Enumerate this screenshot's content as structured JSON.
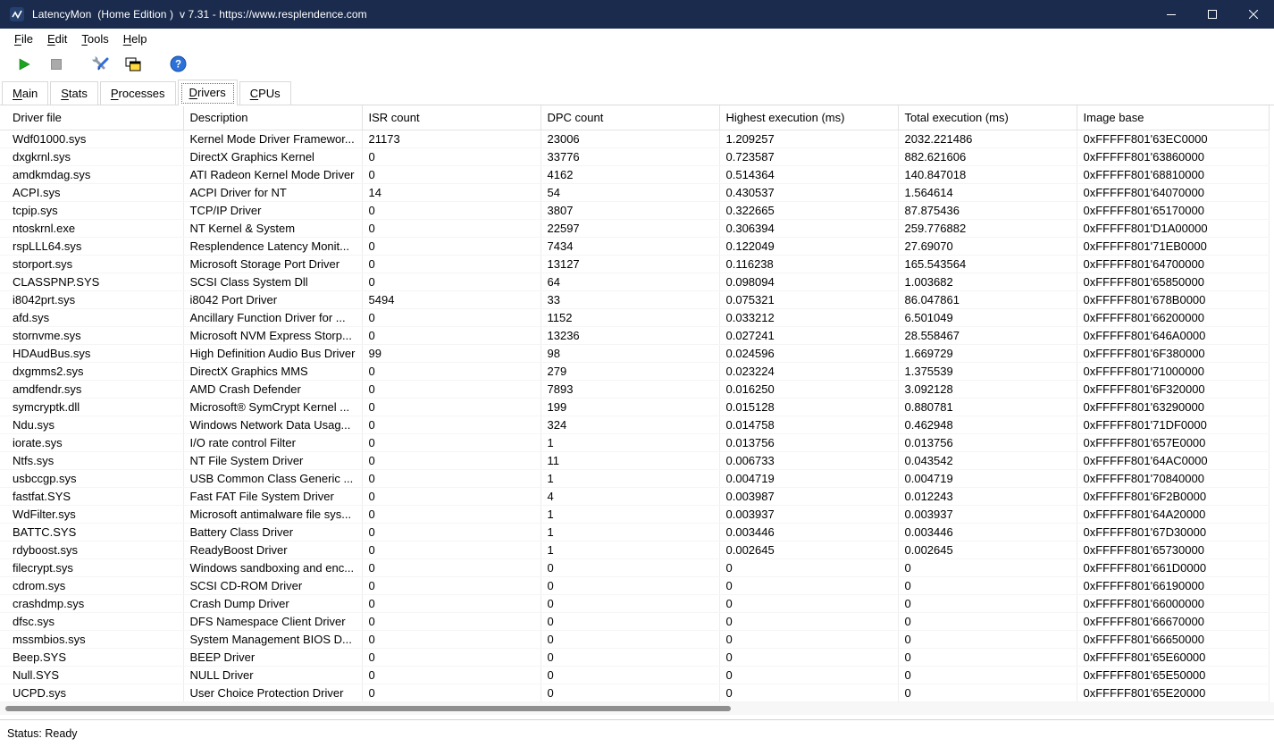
{
  "window": {
    "title": "LatencyMon  (Home Edition )  v 7.31 - https://www.resplendence.com",
    "status": "Status: Ready",
    "controls": [
      "minimize-icon",
      "maximize-icon",
      "close-icon"
    ]
  },
  "colors": {
    "titlebar_bg": "#1b2b4d",
    "play_green": "#1ea321",
    "help_blue": "#2b71d9",
    "copy_yellow": "#ffd83d"
  },
  "menu": {
    "items": [
      {
        "key": "F",
        "rest": "ile"
      },
      {
        "key": "E",
        "rest": "dit"
      },
      {
        "key": "T",
        "rest": "ools"
      },
      {
        "key": "H",
        "rest": "elp"
      }
    ]
  },
  "toolbar": {
    "icons": [
      "start-icon",
      "stop-icon",
      "tools-icon",
      "copy-icon",
      "help-icon"
    ]
  },
  "tabs": {
    "items": [
      {
        "key": "M",
        "rest": "ain"
      },
      {
        "key": "S",
        "rest": "tats"
      },
      {
        "key": "P",
        "rest": "rocesses"
      },
      {
        "key": "D",
        "rest": "rivers"
      },
      {
        "key": "C",
        "rest": "PUs"
      }
    ],
    "active": "Drivers"
  },
  "table": {
    "columns": [
      "Driver file",
      "Description",
      "ISR count",
      "DPC count",
      "Highest execution (ms)",
      "Total execution (ms)",
      "Image base"
    ],
    "rows": [
      [
        "Wdf01000.sys",
        "Kernel Mode Driver Framewor...",
        "21173",
        "23006",
        "1.209257",
        "2032.221486",
        "0xFFFFF801'63EC0000"
      ],
      [
        "dxgkrnl.sys",
        "DirectX Graphics Kernel",
        "0",
        "33776",
        "0.723587",
        "882.621606",
        "0xFFFFF801'63860000"
      ],
      [
        "amdkmdag.sys",
        "ATI Radeon Kernel Mode Driver",
        "0",
        "4162",
        "0.514364",
        "140.847018",
        "0xFFFFF801'68810000"
      ],
      [
        "ACPI.sys",
        "ACPI Driver for NT",
        "14",
        "54",
        "0.430537",
        "1.564614",
        "0xFFFFF801'64070000"
      ],
      [
        "tcpip.sys",
        "TCP/IP Driver",
        "0",
        "3807",
        "0.322665",
        "87.875436",
        "0xFFFFF801'65170000"
      ],
      [
        "ntoskrnl.exe",
        "NT Kernel & System",
        "0",
        "22597",
        "0.306394",
        "259.776882",
        "0xFFFFF801'D1A00000"
      ],
      [
        "rspLLL64.sys",
        "Resplendence Latency Monit...",
        "0",
        "7434",
        "0.122049",
        "27.69070",
        "0xFFFFF801'71EB0000"
      ],
      [
        "storport.sys",
        "Microsoft Storage Port Driver",
        "0",
        "13127",
        "0.116238",
        "165.543564",
        "0xFFFFF801'64700000"
      ],
      [
        "CLASSPNP.SYS",
        "SCSI Class System Dll",
        "0",
        "64",
        "0.098094",
        "1.003682",
        "0xFFFFF801'65850000"
      ],
      [
        "i8042prt.sys",
        "i8042 Port Driver",
        "5494",
        "33",
        "0.075321",
        "86.047861",
        "0xFFFFF801'678B0000"
      ],
      [
        "afd.sys",
        "Ancillary Function Driver for ...",
        "0",
        "1152",
        "0.033212",
        "6.501049",
        "0xFFFFF801'66200000"
      ],
      [
        "stornvme.sys",
        "Microsoft NVM Express Storp...",
        "0",
        "13236",
        "0.027241",
        "28.558467",
        "0xFFFFF801'646A0000"
      ],
      [
        "HDAudBus.sys",
        "High Definition Audio Bus Driver",
        "99",
        "98",
        "0.024596",
        "1.669729",
        "0xFFFFF801'6F380000"
      ],
      [
        "dxgmms2.sys",
        "DirectX Graphics MMS",
        "0",
        "279",
        "0.023224",
        "1.375539",
        "0xFFFFF801'71000000"
      ],
      [
        "amdfendr.sys",
        "AMD Crash Defender",
        "0",
        "7893",
        "0.016250",
        "3.092128",
        "0xFFFFF801'6F320000"
      ],
      [
        "symcryptk.dll",
        "Microsoft® SymCrypt Kernel ...",
        "0",
        "199",
        "0.015128",
        "0.880781",
        "0xFFFFF801'63290000"
      ],
      [
        "Ndu.sys",
        "Windows Network Data Usag...",
        "0",
        "324",
        "0.014758",
        "0.462948",
        "0xFFFFF801'71DF0000"
      ],
      [
        "iorate.sys",
        "I/O rate control Filter",
        "0",
        "1",
        "0.013756",
        "0.013756",
        "0xFFFFF801'657E0000"
      ],
      [
        "Ntfs.sys",
        "NT File System Driver",
        "0",
        "11",
        "0.006733",
        "0.043542",
        "0xFFFFF801'64AC0000"
      ],
      [
        "usbccgp.sys",
        "USB Common Class Generic ...",
        "0",
        "1",
        "0.004719",
        "0.004719",
        "0xFFFFF801'70840000"
      ],
      [
        "fastfat.SYS",
        "Fast FAT File System Driver",
        "0",
        "4",
        "0.003987",
        "0.012243",
        "0xFFFFF801'6F2B0000"
      ],
      [
        "WdFilter.sys",
        "Microsoft antimalware file sys...",
        "0",
        "1",
        "0.003937",
        "0.003937",
        "0xFFFFF801'64A20000"
      ],
      [
        "BATTC.SYS",
        "Battery Class Driver",
        "0",
        "1",
        "0.003446",
        "0.003446",
        "0xFFFFF801'67D30000"
      ],
      [
        "rdyboost.sys",
        "ReadyBoost Driver",
        "0",
        "1",
        "0.002645",
        "0.002645",
        "0xFFFFF801'65730000"
      ],
      [
        "filecrypt.sys",
        "Windows sandboxing and enc...",
        "0",
        "0",
        "0",
        "0",
        "0xFFFFF801'661D0000"
      ],
      [
        "cdrom.sys",
        "SCSI CD-ROM Driver",
        "0",
        "0",
        "0",
        "0",
        "0xFFFFF801'66190000"
      ],
      [
        "crashdmp.sys",
        "Crash Dump Driver",
        "0",
        "0",
        "0",
        "0",
        "0xFFFFF801'66000000"
      ],
      [
        "dfsc.sys",
        "DFS Namespace Client Driver",
        "0",
        "0",
        "0",
        "0",
        "0xFFFFF801'66670000"
      ],
      [
        "mssmbios.sys",
        "System Management BIOS D...",
        "0",
        "0",
        "0",
        "0",
        "0xFFFFF801'66650000"
      ],
      [
        "Beep.SYS",
        "BEEP Driver",
        "0",
        "0",
        "0",
        "0",
        "0xFFFFF801'65E60000"
      ],
      [
        "Null.SYS",
        "NULL Driver",
        "0",
        "0",
        "0",
        "0",
        "0xFFFFF801'65E50000"
      ],
      [
        "UCPD.sys",
        "User Choice Protection Driver",
        "0",
        "0",
        "0",
        "0",
        "0xFFFFF801'65E20000"
      ]
    ]
  }
}
